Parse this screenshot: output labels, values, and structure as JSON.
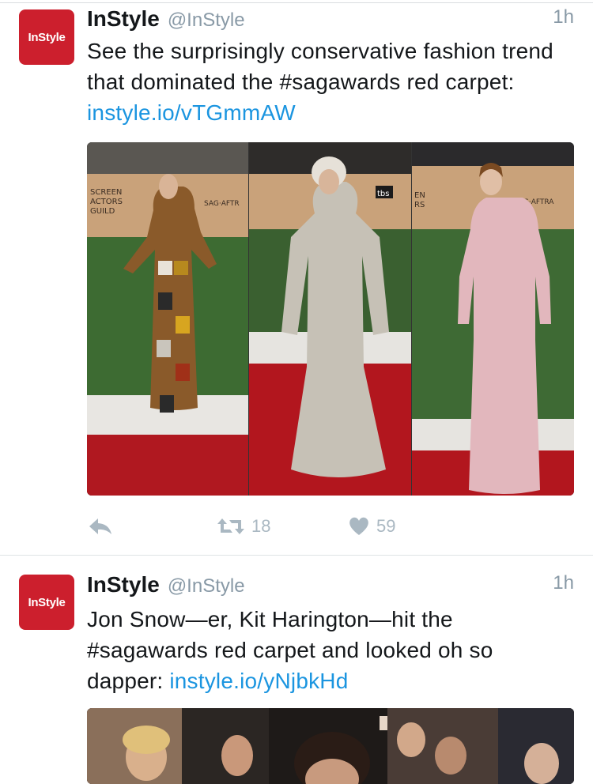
{
  "tweets": [
    {
      "avatar_text": "InStyle",
      "display_name": "InStyle",
      "handle": "@InStyle",
      "time": "1h",
      "text": "See the surprisingly conservative fashion trend that dominated the #sagawards red carpet: ",
      "link": "instyle.io/vTGmmAW",
      "retweets": "18",
      "likes": "59"
    },
    {
      "avatar_text": "InStyle",
      "display_name": "InStyle",
      "handle": "@InStyle",
      "time": "1h",
      "text": "Jon Snow—er, Kit Harington—hit the #sagawards red carpet and looked oh so dapper: ",
      "link": "instyle.io/yNjbkHd"
    }
  ],
  "colors": {
    "brand_red": "#cc1f2d",
    "link_blue": "#1b95e0",
    "muted_gray": "#8899a6",
    "icon_gray": "#aab8c2"
  },
  "icons": [
    "reply-icon",
    "retweet-icon",
    "heart-icon"
  ]
}
